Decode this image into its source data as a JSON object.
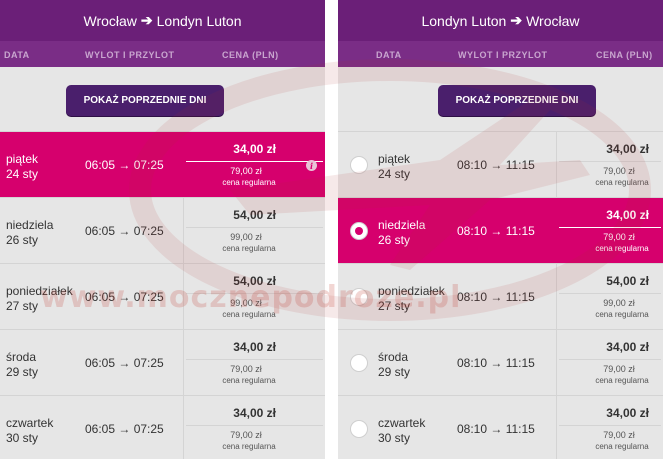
{
  "left": {
    "origin": "Wrocław",
    "destination": "Londyn Luton",
    "columns": {
      "date": "DATA",
      "time": "WYLOT I PRZYLOT",
      "price": "CENA (PLN)"
    },
    "prev_button": "POKAŻ POPRZEDNIE DNI",
    "rows": [
      {
        "weekday": "piątek",
        "date": "24 sty",
        "time": "06:05 → 07:25",
        "price": "34,00 zł",
        "regular_price": "79,00 zł",
        "regular_label": "cena regularna",
        "selected": true
      },
      {
        "weekday": "niedziela",
        "date": "26 sty",
        "time": "06:05 → 07:25",
        "price": "54,00 zł",
        "regular_price": "99,00 zł",
        "regular_label": "cena regularna",
        "selected": false
      },
      {
        "weekday": "poniedziałek",
        "date": "27 sty",
        "time": "06:05 → 07:25",
        "price": "54,00 zł",
        "regular_price": "99,00 zł",
        "regular_label": "cena regularna",
        "selected": false
      },
      {
        "weekday": "środa",
        "date": "29 sty",
        "time": "06:05 → 07:25",
        "price": "34,00 zł",
        "regular_price": "79,00 zł",
        "regular_label": "cena regularna",
        "selected": false
      },
      {
        "weekday": "czwartek",
        "date": "30 sty",
        "time": "06:05 → 07:25",
        "price": "34,00 zł",
        "regular_price": "79,00 zł",
        "regular_label": "cena regularna",
        "selected": false
      }
    ]
  },
  "right": {
    "origin": "Londyn Luton",
    "destination": "Wrocław",
    "columns": {
      "date": "DATA",
      "time": "WYLOT I PRZYLOT",
      "price": "CENA (PLN)"
    },
    "prev_button": "POKAŻ POPRZEDNIE DNI",
    "rows": [
      {
        "weekday": "piątek",
        "date": "24 sty",
        "time": "08:10 → 11:15",
        "price": "34,00 zł",
        "regular_price": "79,00 zł",
        "regular_label": "cena regularna",
        "selected": false
      },
      {
        "weekday": "niedziela",
        "date": "26 sty",
        "time": "08:10 → 11:15",
        "price": "34,00 zł",
        "regular_price": "79,00 zł",
        "regular_label": "cena regularna",
        "selected": true
      },
      {
        "weekday": "poniedziałek",
        "date": "27 sty",
        "time": "08:10 → 11:15",
        "price": "54,00 zł",
        "regular_price": "99,00 zł",
        "regular_label": "cena regularna",
        "selected": false
      },
      {
        "weekday": "środa",
        "date": "29 sty",
        "time": "08:10 → 11:15",
        "price": "34,00 zł",
        "regular_price": "79,00 zł",
        "regular_label": "cena regularna",
        "selected": false
      },
      {
        "weekday": "czwartek",
        "date": "30 sty",
        "time": "08:10 → 11:15",
        "price": "34,00 zł",
        "regular_price": "79,00 zł",
        "regular_label": "cena regularna",
        "selected": false
      }
    ]
  },
  "watermark": "www.mocznepodroze.pl",
  "colors": {
    "header": "#6b1f78",
    "button": "#4a1f6c",
    "selected": "#d6006d",
    "background": "#e6e6e6"
  }
}
